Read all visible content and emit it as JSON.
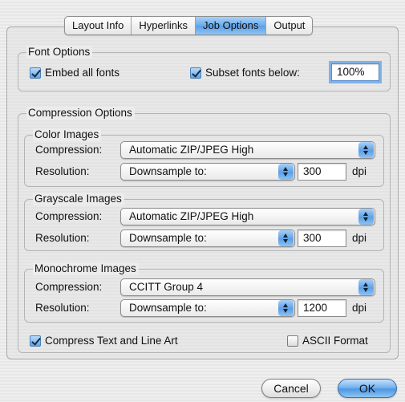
{
  "tabs": [
    {
      "label": "Layout Info",
      "active": false
    },
    {
      "label": "Hyperlinks",
      "active": false
    },
    {
      "label": "Job Options",
      "active": true
    },
    {
      "label": "Output",
      "active": false
    }
  ],
  "font_options": {
    "title": "Font Options",
    "embed_all_label": "Embed all fonts",
    "embed_all_checked": true,
    "subset_label": "Subset fonts below:",
    "subset_checked": true,
    "subset_value": "100%"
  },
  "compression": {
    "title": "Compression Options",
    "compression_label": "Compression:",
    "resolution_label": "Resolution:",
    "dpi_unit": "dpi",
    "color": {
      "title": "Color Images",
      "compression": "Automatic ZIP/JPEG High",
      "resolution": "Downsample to:",
      "dpi": "300"
    },
    "grayscale": {
      "title": "Grayscale Images",
      "compression": "Automatic ZIP/JPEG High",
      "resolution": "Downsample to:",
      "dpi": "300"
    },
    "monochrome": {
      "title": "Monochrome Images",
      "compression": "CCITT Group 4",
      "resolution": "Downsample to:",
      "dpi": "1200"
    },
    "compress_text_label": "Compress Text and Line Art",
    "compress_text_checked": true,
    "ascii_label": "ASCII Format",
    "ascii_checked": false
  },
  "buttons": {
    "cancel": "Cancel",
    "ok": "OK"
  },
  "colors": {
    "accent": "#5a9fe6",
    "background": "#ececec"
  }
}
